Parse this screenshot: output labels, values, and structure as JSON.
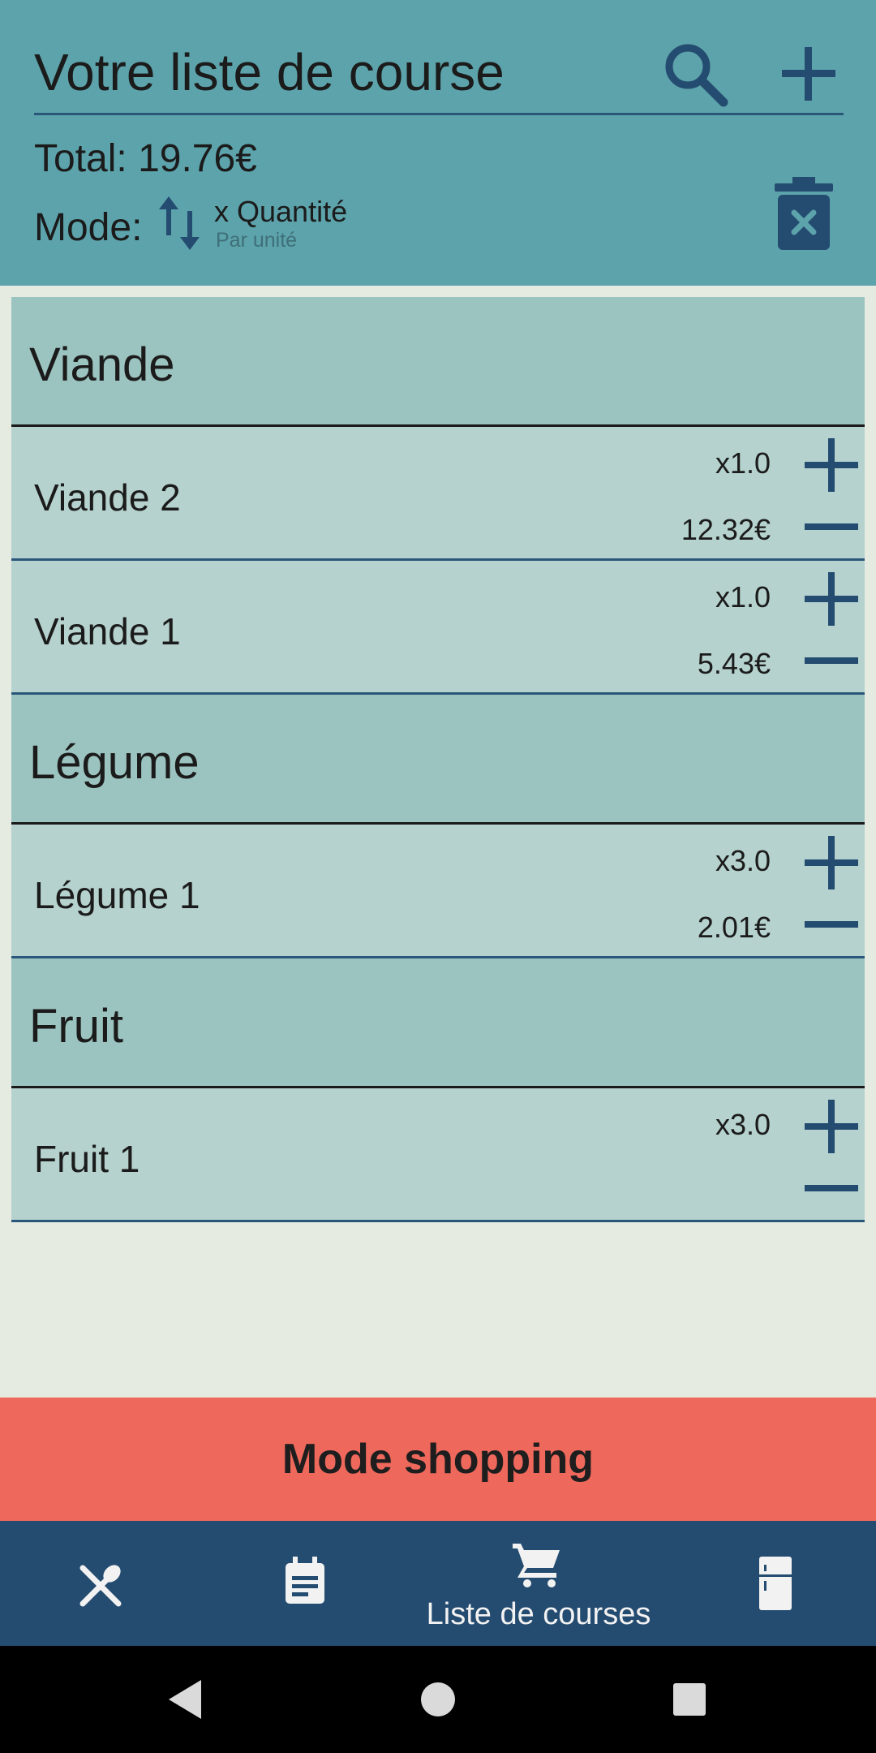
{
  "header": {
    "title": "Votre liste de course",
    "total": "Total: 19.76€",
    "mode_label": "Mode:",
    "mode_primary": "x Quantité",
    "mode_secondary": "Par unité",
    "icons": {
      "search": "search-icon",
      "add": "plus-icon",
      "delete": "trash-icon",
      "mode": "swap-vertical-icon"
    }
  },
  "categories": [
    {
      "label": "Viande",
      "items": [
        {
          "name": "Viande 2",
          "qty": "x1.0",
          "price": "12.32€"
        },
        {
          "name": "Viande 1",
          "qty": "x1.0",
          "price": "5.43€"
        }
      ]
    },
    {
      "label": "Légume",
      "items": [
        {
          "name": "Légume 1",
          "qty": "x3.0",
          "price": "2.01€"
        }
      ]
    },
    {
      "label": "Fruit",
      "items": [
        {
          "name": "Fruit 1",
          "qty": "x3.0",
          "price": ""
        }
      ]
    }
  ],
  "shopping_button": "Mode shopping",
  "bottom_nav": {
    "items": [
      {
        "icon": "utensils-icon",
        "label": ""
      },
      {
        "icon": "calendar-icon",
        "label": ""
      },
      {
        "icon": "cart-icon",
        "label": "Liste de courses",
        "active": true
      },
      {
        "icon": "fridge-icon",
        "label": ""
      }
    ]
  },
  "colors": {
    "header_bg": "#5da3ab",
    "accent": "#2a5779",
    "category_bg": "#9bc3bf",
    "item_bg": "#b5d2ce",
    "shopping_bg": "#ee685b",
    "nav_bg": "#244b70"
  }
}
